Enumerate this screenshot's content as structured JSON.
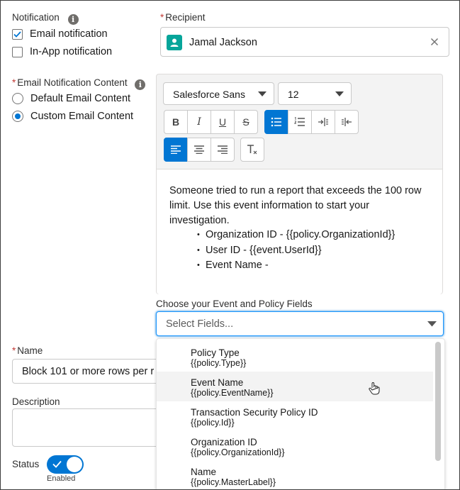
{
  "notification": {
    "label": "Notification",
    "email_label": "Email notification",
    "email_checked": true,
    "inapp_label": "In-App notification",
    "inapp_checked": false
  },
  "recipient": {
    "label": "Recipient",
    "value": "Jamal Jackson",
    "icon": "user-icon"
  },
  "email_content": {
    "label": "Email Notification Content",
    "default_label": "Default Email Content",
    "custom_label": "Custom Email Content",
    "selected": "custom"
  },
  "editor": {
    "font_family": "Salesforce Sans",
    "font_size": "12",
    "body_line1": "Someone tried to run a report that exceeds the 100 row",
    "body_line2": "limit. Use this event information to start your",
    "body_line3": "investigation.",
    "bullets": [
      "Organization ID - {{policy.OrganizationId}}",
      "User ID - {{event.UserId}}",
      "Event Name -"
    ]
  },
  "fields_picker": {
    "label": "Choose your Event and Policy Fields",
    "placeholder": "Select Fields...",
    "options": [
      {
        "name": "Policy Type",
        "token": "{{policy.Type}}"
      },
      {
        "name": "Event Name",
        "token": "{{policy.EventName}}"
      },
      {
        "name": "Transaction Security Policy ID",
        "token": "{{policy.Id}}"
      },
      {
        "name": "Organization ID",
        "token": "{{policy.OrganizationId}}"
      },
      {
        "name": "Name",
        "token": "{{policy.MasterLabel}}"
      }
    ],
    "hovered_index": 1
  },
  "name_field": {
    "label": "Name",
    "value": "Block 101 or more rows per r"
  },
  "description": {
    "label": "Description",
    "value": ""
  },
  "status": {
    "label": "Status",
    "toggle_text": "Enabled",
    "enabled": true
  },
  "colors": {
    "brand": "#0176d3",
    "required": "#c23934",
    "hover": "#f3f3f3"
  }
}
